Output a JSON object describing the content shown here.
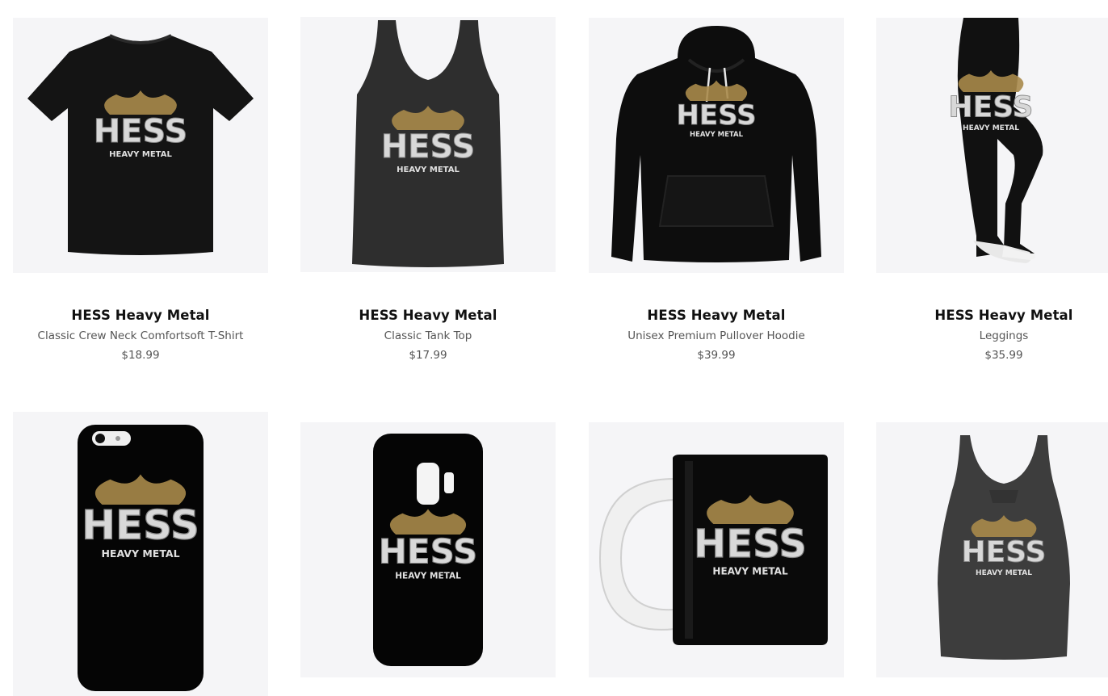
{
  "colors": {
    "card_bg": "#f5f5f7",
    "title": "#111111",
    "subtitle": "#555555",
    "garment_black": "#141414",
    "garment_heather": "#3d3d3d",
    "logo_gold": "#a88a4a",
    "logo_silver": "#d8d8d8"
  },
  "logo": {
    "main": "HESS",
    "sub": "HEAVY METAL"
  },
  "products": [
    {
      "title": "HESS Heavy Metal",
      "subtitle": "Classic Crew Neck Comfortsoft T-Shirt",
      "price": "$18.99",
      "image_icon": "black-tshirt-icon"
    },
    {
      "title": "HESS Heavy Metal",
      "subtitle": "Classic Tank Top",
      "price": "$17.99",
      "image_icon": "tank-top-icon"
    },
    {
      "title": "HESS Heavy Metal",
      "subtitle": "Unisex Premium Pullover Hoodie",
      "price": "$39.99",
      "image_icon": "hoodie-icon"
    },
    {
      "title": "HESS Heavy Metal",
      "subtitle": "Leggings",
      "price": "$35.99",
      "image_icon": "leggings-icon"
    },
    {
      "image_icon": "iphone-case-icon"
    },
    {
      "image_icon": "galaxy-case-icon"
    },
    {
      "image_icon": "mug-icon"
    },
    {
      "image_icon": "racerback-tank-icon"
    }
  ]
}
